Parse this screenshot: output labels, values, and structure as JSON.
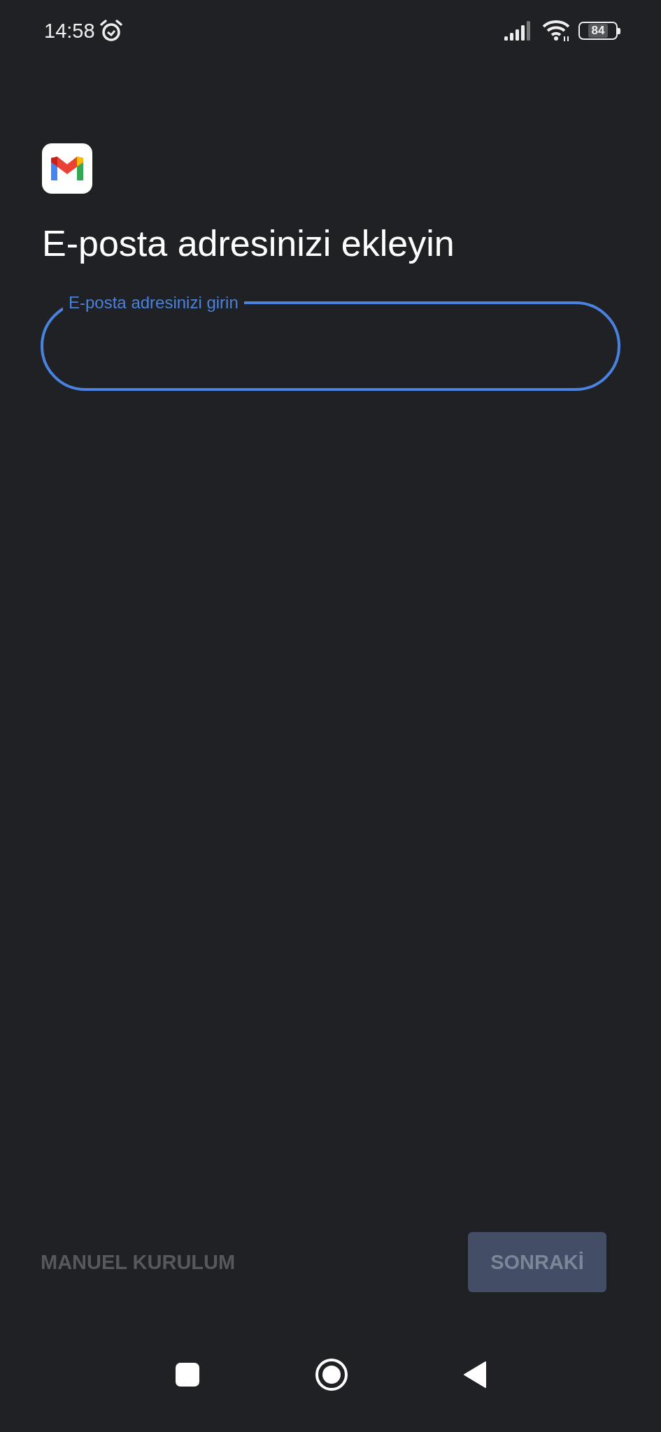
{
  "status_bar": {
    "time": "14:58",
    "alarm": true,
    "battery": "84"
  },
  "header": {
    "title": "E-posta adresinizi ekleyin"
  },
  "email_field": {
    "label": "E-posta adresinizi girin",
    "focused": true
  },
  "actions": [
    {
      "kind": "text",
      "label": "MANUEL KURULUM",
      "disabled": true
    },
    {
      "kind": "filled",
      "label": "SONRAKİ",
      "disabled": true
    }
  ]
}
